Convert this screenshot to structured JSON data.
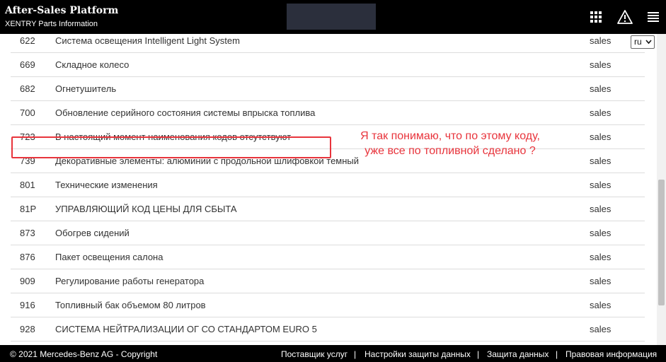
{
  "header": {
    "title": "After-Sales Platform",
    "subtitle": "XENTRY Parts Information",
    "icons": [
      "apps-grid-icon",
      "warning-icon",
      "menu-icon"
    ]
  },
  "language_select": {
    "value": "ru"
  },
  "rows": [
    {
      "code": "622",
      "name": "Система освещения Intelligent Light System",
      "category": "sales"
    },
    {
      "code": "669",
      "name": "Складное колесо",
      "category": "sales"
    },
    {
      "code": "682",
      "name": "Огнетушитель",
      "category": "sales"
    },
    {
      "code": "700",
      "name": "Обновление серийного состояния системы впрыска топлива",
      "category": "sales"
    },
    {
      "code": "723",
      "name": "В настоящий момент наименования кодов отсутствуют",
      "category": "sales"
    },
    {
      "code": "739",
      "name": "Декоративные элементы: алюминий с продольной шлифовкой темный",
      "category": "sales"
    },
    {
      "code": "801",
      "name": "Технические изменения",
      "category": "sales"
    },
    {
      "code": "81P",
      "name": "УПРАВЛЯЮЩИЙ КОД ЦЕНЫ ДЛЯ СБЫТА",
      "category": "sales"
    },
    {
      "code": "873",
      "name": "Обогрев сидений",
      "category": "sales"
    },
    {
      "code": "876",
      "name": "Пакет освещения салона",
      "category": "sales"
    },
    {
      "code": "909",
      "name": "Регулирование работы генератора",
      "category": "sales"
    },
    {
      "code": "916",
      "name": "Топливный бак объемом 80 литров",
      "category": "sales"
    },
    {
      "code": "928",
      "name": "СИСТЕМА НЕЙТРАЛИЗАЦИИ ОГ СО СТАНДАРТОМ EURO 5",
      "category": "sales"
    }
  ],
  "annotation": {
    "line1": "Я так понимаю, что по этому коду,",
    "line2": "уже все по топливной сделано ?",
    "color": "#e8343c"
  },
  "footer": {
    "copyright": "© 2021 Mercedes-Benz AG - Copyright",
    "links": [
      "Поставщик услуг",
      "Настройки защиты данных",
      "Защита данных",
      "Правовая информация"
    ],
    "separator": "|"
  }
}
